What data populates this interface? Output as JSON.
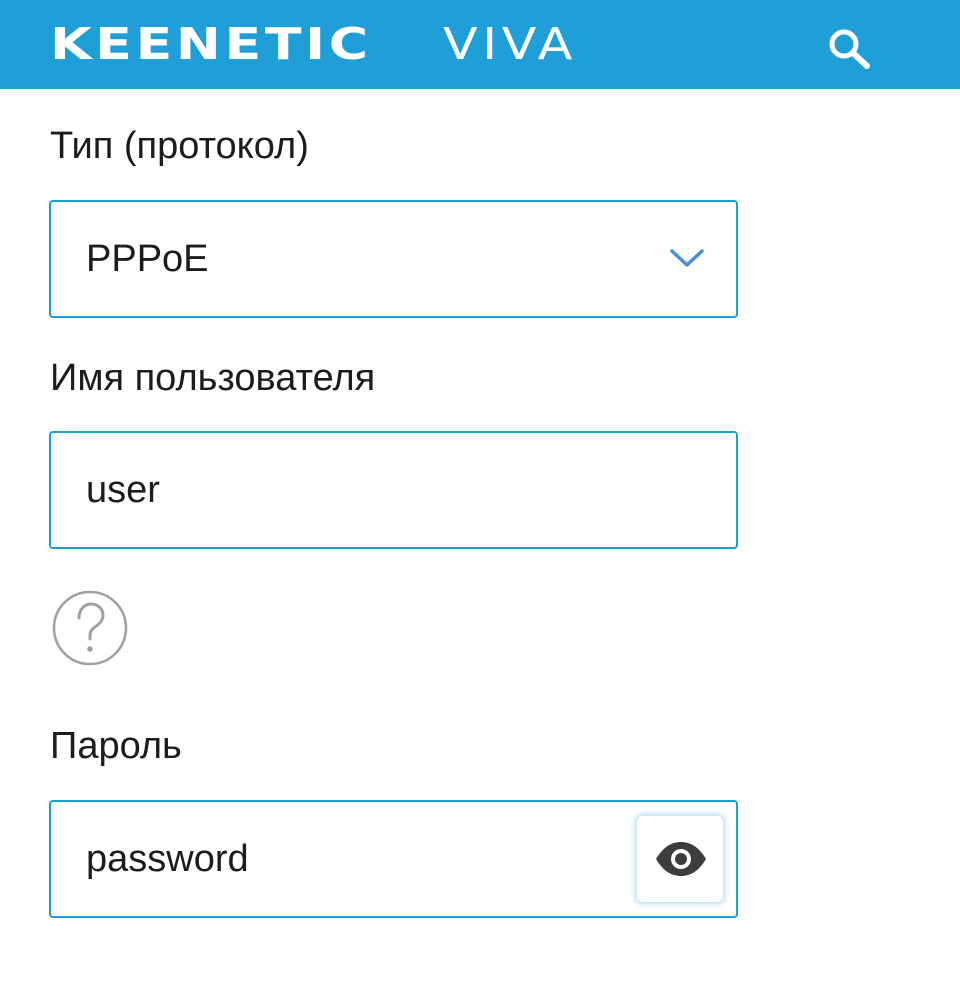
{
  "header": {
    "brand_name": "KEENETIC",
    "brand_model": "VIVA",
    "search_icon": "search-icon",
    "background_color": "#1f9ed8"
  },
  "form": {
    "protocol": {
      "label": "Тип (протокол)",
      "selected_value": "PPPoE",
      "icon": "chevron-down-icon"
    },
    "username": {
      "label": "Имя пользователя",
      "value": "user"
    },
    "help": {
      "icon": "help-icon"
    },
    "password": {
      "label": "Пароль",
      "value": "password",
      "icon": "eye-icon"
    }
  },
  "colors": {
    "accent": "#1f9ed8",
    "text": "#1c1c1c",
    "help_ring": "#a0a0a0",
    "chevron": "#4a8fd0"
  }
}
